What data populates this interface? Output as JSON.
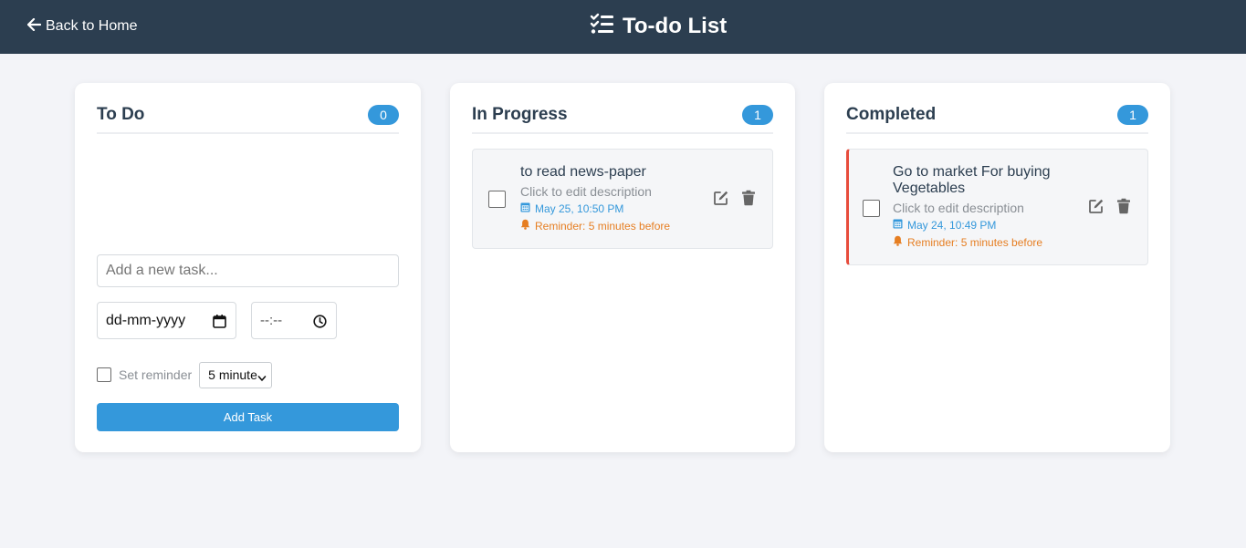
{
  "header": {
    "back_label": "Back to Home",
    "title": "To-do List"
  },
  "columns": [
    {
      "title": "To Do",
      "count": "0"
    },
    {
      "title": "In Progress",
      "count": "1"
    },
    {
      "title": "Completed",
      "count": "1"
    }
  ],
  "tasks": {
    "in_progress": [
      {
        "title": "to read news-paper",
        "description": "Click to edit description",
        "date": "May 25, 10:50 PM",
        "reminder": "Reminder: 5 minutes before",
        "checked": false
      }
    ],
    "completed": [
      {
        "title": "Go to market For buying Vegetables",
        "description": "Click to edit description",
        "date": "May 24, 10:49 PM",
        "reminder": "Reminder: 5 minutes before",
        "checked": false,
        "status_color": "#e74c3c"
      }
    ]
  },
  "form": {
    "task_placeholder": "Add a new task...",
    "date_placeholder": "dd-mm-yyyy",
    "time_placeholder": "--:--",
    "reminder_label": "Set reminder",
    "reminder_checked": false,
    "reminder_selected": "5 minutes",
    "add_label": "Add Task"
  },
  "colors": {
    "header_bg": "#2c3e50",
    "accent": "#3498db",
    "date_text": "#3498db",
    "reminder_text": "#e67e22",
    "overdue_border": "#e74c3c",
    "page_bg": "#f3f4f8"
  },
  "icons": {
    "back": "arrow-left-icon",
    "title": "checklist-icon",
    "date": "calendar-icon",
    "reminder": "bell-icon",
    "edit": "edit-icon",
    "delete": "trash-icon",
    "date_picker": "calendar-picker-icon",
    "time_picker": "clock-icon"
  }
}
